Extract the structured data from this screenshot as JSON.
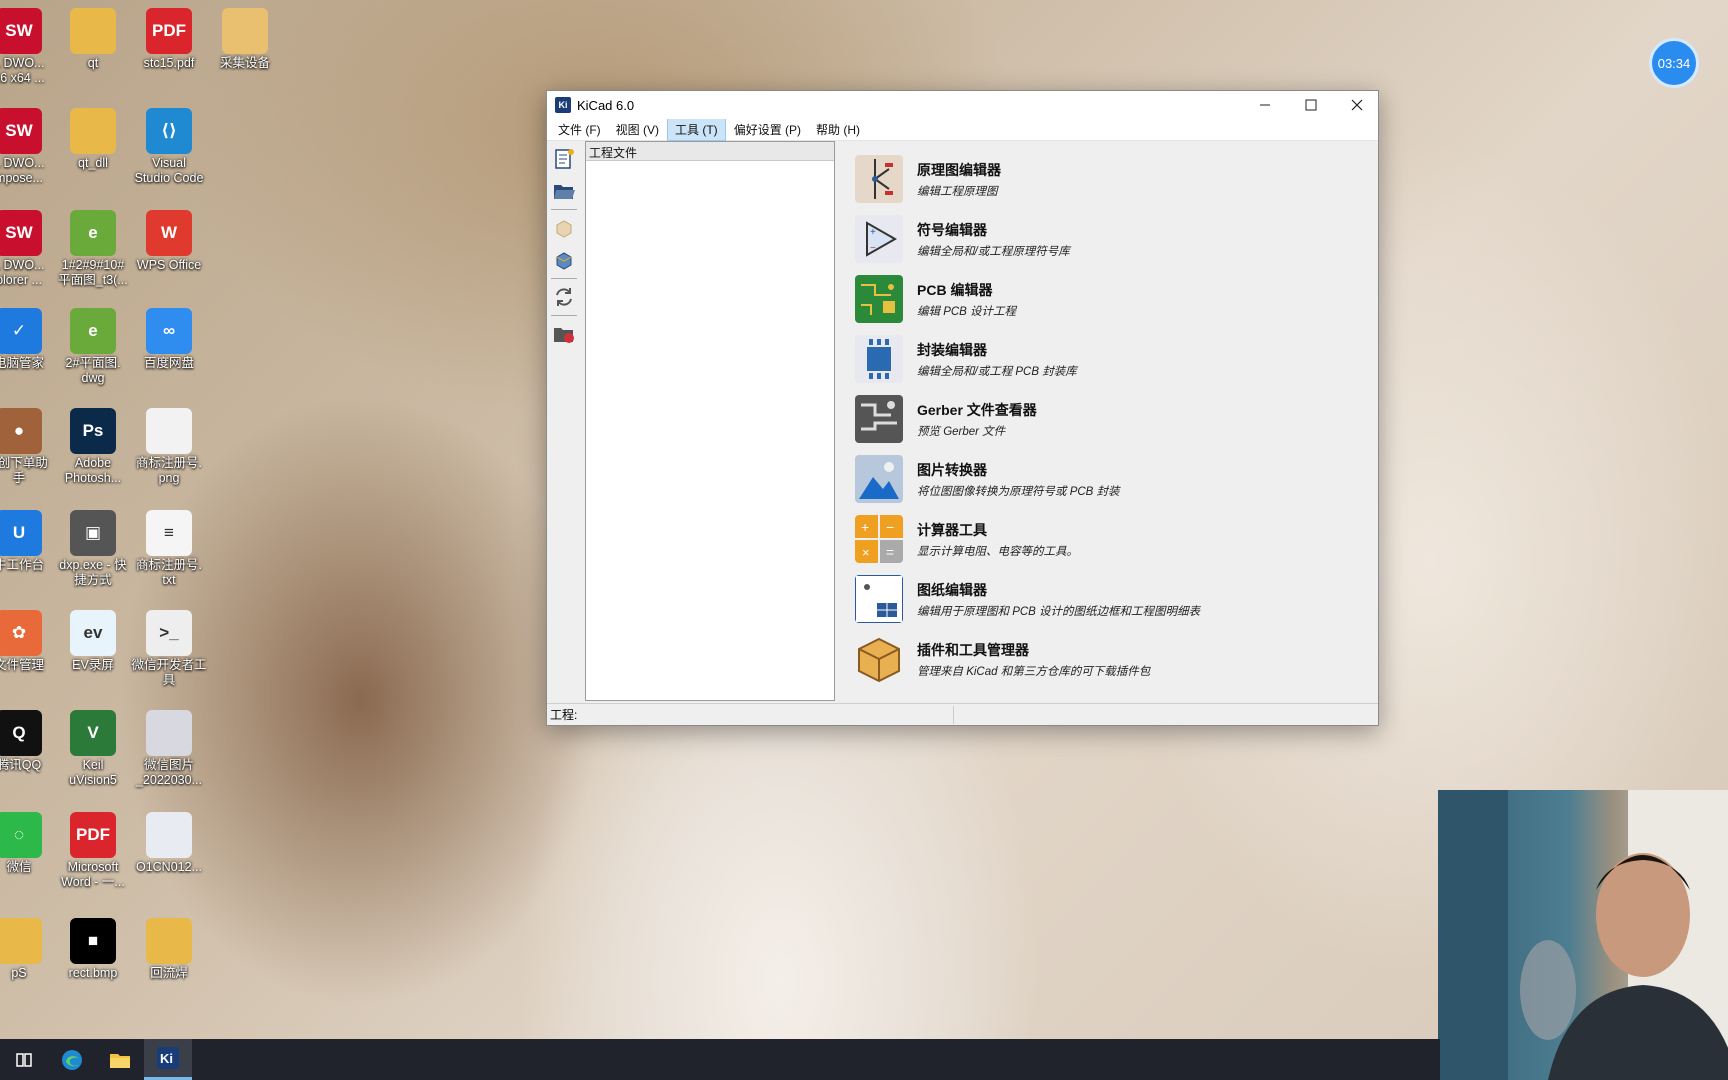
{
  "clock": "03:34",
  "desktop_icons": [
    {
      "label": "L DWO...\n16 x64 ...",
      "icon": "solidworks-icon",
      "glyph": "SW",
      "color": "#c8102e"
    },
    {
      "label": "qt",
      "icon": "folder-icon",
      "glyph": "",
      "color": "#e8b848"
    },
    {
      "label": "stc15.pdf",
      "icon": "pdf-icon",
      "glyph": "PDF",
      "color": "#d9252b"
    },
    {
      "label": "采集设备",
      "icon": "folder-icon",
      "glyph": "",
      "color": "#e8c070"
    },
    {
      "label": "L DWO...\nmpose...",
      "icon": "solidworks-icon",
      "glyph": "SW",
      "color": "#c8102e"
    },
    {
      "label": "qt_dll",
      "icon": "folder-icon",
      "glyph": "",
      "color": "#e8b848"
    },
    {
      "label": "Visual\nStudio Code",
      "icon": "vscode-icon",
      "glyph": "⟨⟩",
      "color": "#1f8ad2"
    },
    {
      "label": "L DWO...\nplorer ...",
      "icon": "solidworks-icon",
      "glyph": "SW",
      "color": "#c8102e"
    },
    {
      "label": "1#2#9#10#\n平面图_t3(...",
      "icon": "dwg-icon",
      "glyph": "e",
      "color": "#6aaa3a"
    },
    {
      "label": "WPS Office",
      "icon": "wps-icon",
      "glyph": "W",
      "color": "#e03a2f"
    },
    {
      "label": "电脑管家",
      "icon": "pc-manager-icon",
      "glyph": "✓",
      "color": "#1f7ae0"
    },
    {
      "label": "2#平面图.\ndwg",
      "icon": "dwg-icon",
      "glyph": "e",
      "color": "#6aaa3a"
    },
    {
      "label": "百度网盘",
      "icon": "baidu-netdisk-icon",
      "glyph": "∞",
      "color": "#2f8df0"
    },
    {
      "label": "Z创下单助\n手",
      "icon": "bear-icon",
      "glyph": "●",
      "color": "#a0623a"
    },
    {
      "label": "Adobe\nPhotosh...",
      "icon": "photoshop-icon",
      "glyph": "Ps",
      "color": "#0b2a4a"
    },
    {
      "label": "商标注册号.\npng",
      "icon": "image-file-icon",
      "glyph": "",
      "color": "#f2f2f2"
    },
    {
      "label": "牛工作台",
      "icon": "qianniu-icon",
      "glyph": "U",
      "color": "#1f7ae0"
    },
    {
      "label": "dxp.exe - 快\n捷方式",
      "icon": "dxp-icon",
      "glyph": "▣",
      "color": "#555555"
    },
    {
      "label": "商标注册号.\ntxt",
      "icon": "text-file-icon",
      "glyph": "≡",
      "color": "#f5f5f5"
    },
    {
      "label": "文件管理",
      "icon": "file-manager-icon",
      "glyph": "✿",
      "color": "#e86a3a"
    },
    {
      "label": "EV录屏",
      "icon": "ev-recorder-icon",
      "glyph": "ev",
      "color": "#e8f4fb"
    },
    {
      "label": "微信开发者工\n具",
      "icon": "wechat-devtools-icon",
      "glyph": ">_",
      "color": "#eeeeee"
    },
    {
      "label": "腾讯QQ",
      "icon": "qq-icon",
      "glyph": "Q",
      "color": "#111111"
    },
    {
      "label": "Keil\nuVision5",
      "icon": "keil-icon",
      "glyph": "V",
      "color": "#2c7a3a"
    },
    {
      "label": "微信图片\n_2022030...",
      "icon": "image-file-icon",
      "glyph": "",
      "color": "#d8d8e0"
    },
    {
      "label": "微信",
      "icon": "wechat-icon",
      "glyph": "◌",
      "color": "#2db84a"
    },
    {
      "label": "Microsoft\nWord - 一...",
      "icon": "pdf-icon",
      "glyph": "PDF",
      "color": "#d9252b"
    },
    {
      "label": "O1CN012...",
      "icon": "image-file-icon",
      "glyph": "",
      "color": "#e8ecf2"
    },
    {
      "label": "pS",
      "icon": "folder-icon",
      "glyph": "",
      "color": "#e8b848"
    },
    {
      "label": "rect.bmp",
      "icon": "bmp-icon",
      "glyph": "■",
      "color": "#000000"
    },
    {
      "label": "回流焊",
      "icon": "folder-icon",
      "glyph": "",
      "color": "#e8b848"
    }
  ],
  "window": {
    "logo": "Ki",
    "title": "KiCad 6.0",
    "menu": [
      {
        "label": "文件 (F)"
      },
      {
        "label": "视图 (V)"
      },
      {
        "label": "工具 (T)"
      },
      {
        "label": "偏好设置 (P)"
      },
      {
        "label": "帮助 (H)"
      }
    ],
    "tree_header": "工程文件",
    "status_label": "工程:",
    "tools": [
      {
        "title": "原理图编辑器",
        "desc": "编辑工程原理图",
        "icon": "schematic-editor-icon"
      },
      {
        "title": "符号编辑器",
        "desc": "编辑全局和/或工程原理符号库",
        "icon": "symbol-editor-icon"
      },
      {
        "title": "PCB 编辑器",
        "desc": "编辑 PCB 设计工程",
        "icon": "pcb-editor-icon"
      },
      {
        "title": "封装编辑器",
        "desc": "编辑全局和/或工程 PCB 封装库",
        "icon": "footprint-editor-icon"
      },
      {
        "title": "Gerber 文件查看器",
        "desc": "预览 Gerber 文件",
        "icon": "gerber-viewer-icon"
      },
      {
        "title": "图片转换器",
        "desc": "将位图图像转换为原理符号或 PCB 封装",
        "icon": "image-converter-icon"
      },
      {
        "title": "计算器工具",
        "desc": "显示计算电阻、电容等的工具。",
        "icon": "calculator-icon"
      },
      {
        "title": "图纸编辑器",
        "desc": "编辑用于原理图和 PCB 设计的图纸边框和工程图明细表",
        "icon": "drawing-sheet-editor-icon"
      },
      {
        "title": "插件和工具管理器",
        "desc": "管理来自 KiCad 和第三方仓库的可下载插件包",
        "icon": "plugin-manager-icon"
      }
    ]
  }
}
